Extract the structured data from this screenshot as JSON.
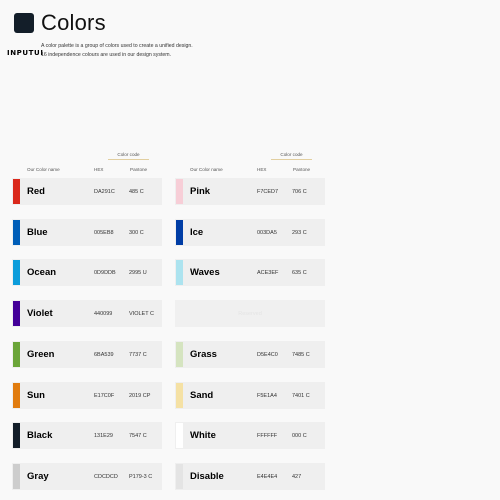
{
  "header": {
    "title": "Colors",
    "swatch_color": "#131E29",
    "logo_text": "INPUTUI",
    "description_line1": "A color palette is a group of colors used to create a unified design.",
    "description_line2": "16 independence colours are used in our design system."
  },
  "table_headers": {
    "color_code": "Color code",
    "name": "Our Color name",
    "hex": "HEX",
    "pantone": "Pantone"
  },
  "left_colors": [
    {
      "name": "Red",
      "hex": "DA291C",
      "pantone": "485 C",
      "color": "#DA291C"
    },
    {
      "name": "Blue",
      "hex": "005EB8",
      "pantone": "300 C",
      "color": "#005EB8"
    },
    {
      "name": "Ocean",
      "hex": "0D9DDB",
      "pantone": "2995 U",
      "color": "#0D9DDB"
    },
    {
      "name": "Violet",
      "hex": "440099",
      "pantone": "VIOLET C",
      "color": "#440099"
    },
    {
      "name": "Green",
      "hex": "6BA539",
      "pantone": "7737 C",
      "color": "#6BA539"
    },
    {
      "name": "Sun",
      "hex": "E17C0F",
      "pantone": "2019 CP",
      "color": "#E17C0F"
    },
    {
      "name": "Black",
      "hex": "131E29",
      "pantone": "7547 C",
      "color": "#131E29"
    },
    {
      "name": "Gray",
      "hex": "CDCDCD",
      "pantone": "P179-3 C",
      "color": "#CDCDCD"
    }
  ],
  "right_colors": [
    {
      "name": "Pink",
      "hex": "F7CED7",
      "pantone": "706 C",
      "color": "#F7CED7"
    },
    {
      "name": "Ice",
      "hex": "003DA5",
      "pantone": "293 C",
      "color": "#003DA5"
    },
    {
      "name": "Waves",
      "hex": "ACE3EF",
      "pantone": "635 C",
      "color": "#ACE3EF"
    },
    {
      "name": "",
      "hex": "",
      "pantone": "",
      "color": "",
      "placeholder": "Reserved"
    },
    {
      "name": "Grass",
      "hex": "D5E4C0",
      "pantone": "7485 C",
      "color": "#D5E4C0"
    },
    {
      "name": "Sand",
      "hex": "F5E1A4",
      "pantone": "7401 C",
      "color": "#F5E1A4"
    },
    {
      "name": "White",
      "hex": "FFFFFF",
      "pantone": "000 C",
      "color": "#FFFFFF"
    },
    {
      "name": "Disable",
      "hex": "E4E4E4",
      "pantone": "427",
      "color": "#E4E4E4"
    }
  ]
}
